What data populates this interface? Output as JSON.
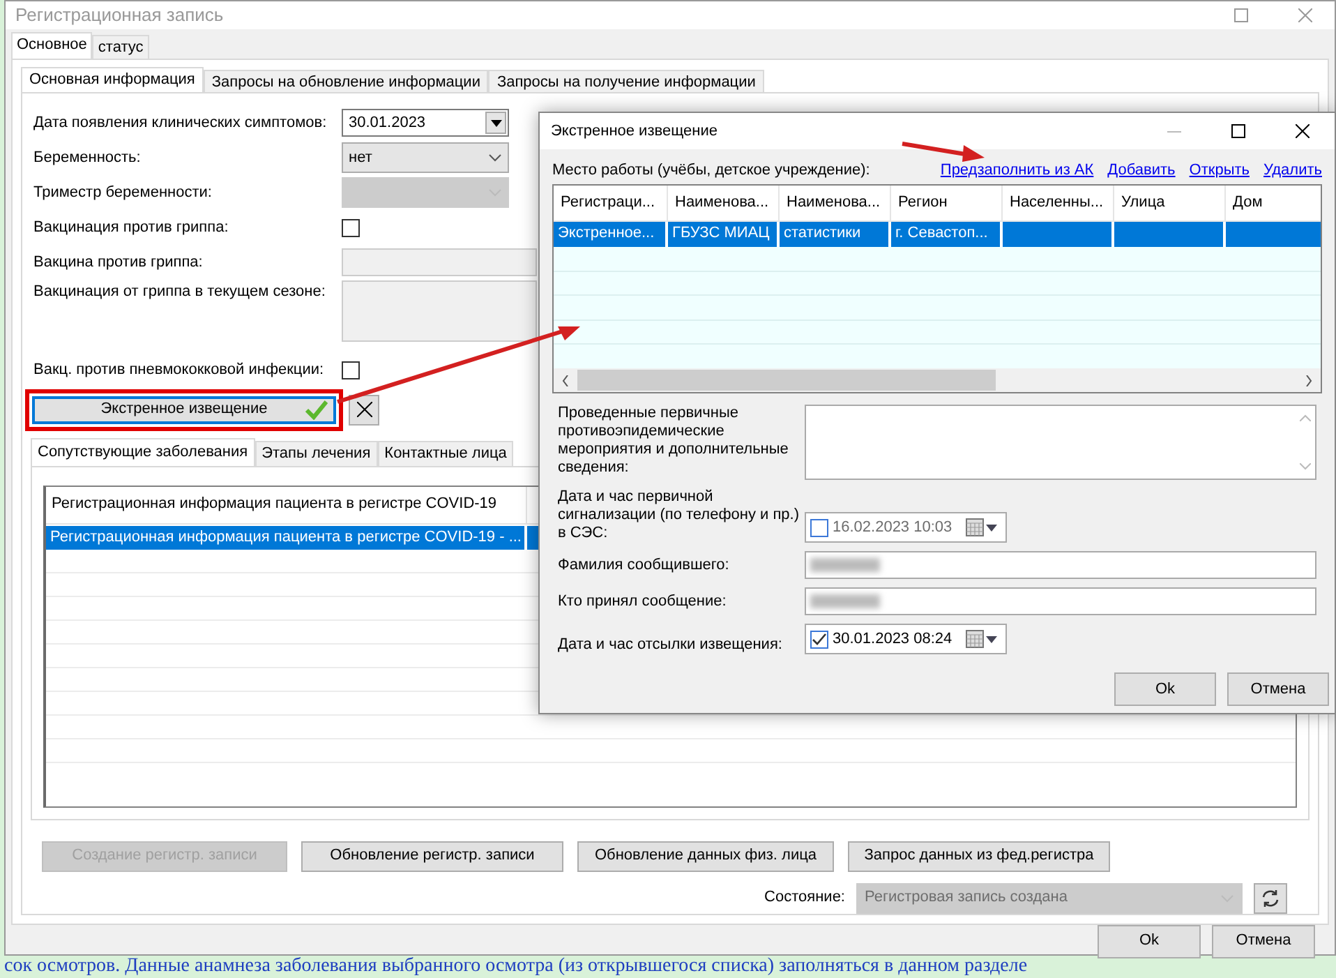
{
  "window": {
    "title": "Регистрационная запись"
  },
  "outer_tabs": [
    {
      "label": "Основное",
      "selected": true
    },
    {
      "label": "статус",
      "selected": false
    }
  ],
  "inner_tabs": [
    {
      "label": "Основная информация",
      "selected": true
    },
    {
      "label": "Запросы на обновление информации",
      "selected": false
    },
    {
      "label": "Запросы на получение информации",
      "selected": false
    }
  ],
  "form_fields": [
    {
      "kind": "date",
      "label": "Дата появления клинических симптомов:",
      "value": "30.01.2023"
    },
    {
      "kind": "select",
      "label": "Беременность:",
      "value": "нет",
      "disabled": false
    },
    {
      "kind": "select",
      "label": "Триместр беременности:",
      "disabled": true
    },
    {
      "kind": "checkbox",
      "label": "Вакцинация против гриппа:",
      "checked": false
    },
    {
      "kind": "text",
      "label": "Вакцина против гриппа:"
    },
    {
      "kind": "textarea",
      "label": "Вакцинация от гриппа в текущем сезоне:"
    },
    {
      "kind": "checkbox",
      "label": "Вакц. против пневмококковой инфекции:",
      "checked": false
    }
  ],
  "emergency_button": {
    "label": "Экстренное извещение",
    "highlighted": true
  },
  "sub_tabs": [
    {
      "label": "Сопутствующие заболевания",
      "selected": true
    },
    {
      "label": "Этапы лечения",
      "selected": false
    },
    {
      "label": "Контактные лица",
      "selected": false
    }
  ],
  "list": {
    "columns": [
      "Регистрационная информация пациента в регистре COVID-19"
    ],
    "rows": [
      {
        "cells": [
          "Регистрационная информация пациента в регистре COVID-19 - ..."
        ],
        "selected": true
      }
    ]
  },
  "action_buttons": [
    {
      "label": "Создание регистр. записи",
      "disabled": true
    },
    {
      "label": "Обновление регистр. записи",
      "disabled": false
    },
    {
      "label": "Обновление данных физ. лица",
      "disabled": false
    },
    {
      "label": "Запрос данных из фед.регистра",
      "disabled": false
    }
  ],
  "status": {
    "label": "Состояние:",
    "value": "Регистровая запись создана",
    "disabled": true
  },
  "footer_buttons": [
    "Ok",
    "Отмена"
  ],
  "dialog": {
    "title": "Экстренное извещение",
    "workplace_label": "Место работы (учёбы, детское учреждение):",
    "links": [
      "Предзаполнить из АК",
      "Добавить",
      "Открыть",
      "Удалить"
    ],
    "table": {
      "columns": [
        "Регистраци...",
        "Наименова...",
        "Наименова...",
        "Регион",
        "Населенны...",
        "Улица",
        "Дом"
      ],
      "rows": [
        {
          "cells": [
            "Экстренное...",
            "ГБУЗС МИАЦ",
            "статистики",
            "г. Севастоп...",
            "",
            "",
            ""
          ],
          "selected": true
        }
      ]
    },
    "fields": [
      {
        "kind": "textarea",
        "label": "Проведенные первичные противоэпидемические мероприятия и дополнительные сведения:"
      },
      {
        "kind": "datetime",
        "label": "Дата и час первичной сигнализации (по телефону и пр.) в СЭС:",
        "value": "16.02.2023 10:03",
        "checked": false
      },
      {
        "kind": "redacted",
        "label": "Фамилия сообщившего:"
      },
      {
        "kind": "redacted",
        "label": "Кто принял сообщение:"
      },
      {
        "kind": "datetime",
        "label": "Дата и час отсылки извещения:",
        "value": "30.01.2023 08:24",
        "checked": true
      }
    ],
    "buttons": [
      "Ok",
      "Отмена"
    ]
  },
  "background_text": "сок осмотров. Данные анамнеза заболевания выбранного осмотра (из открывшегося списка) заполняться в данном разделе"
}
